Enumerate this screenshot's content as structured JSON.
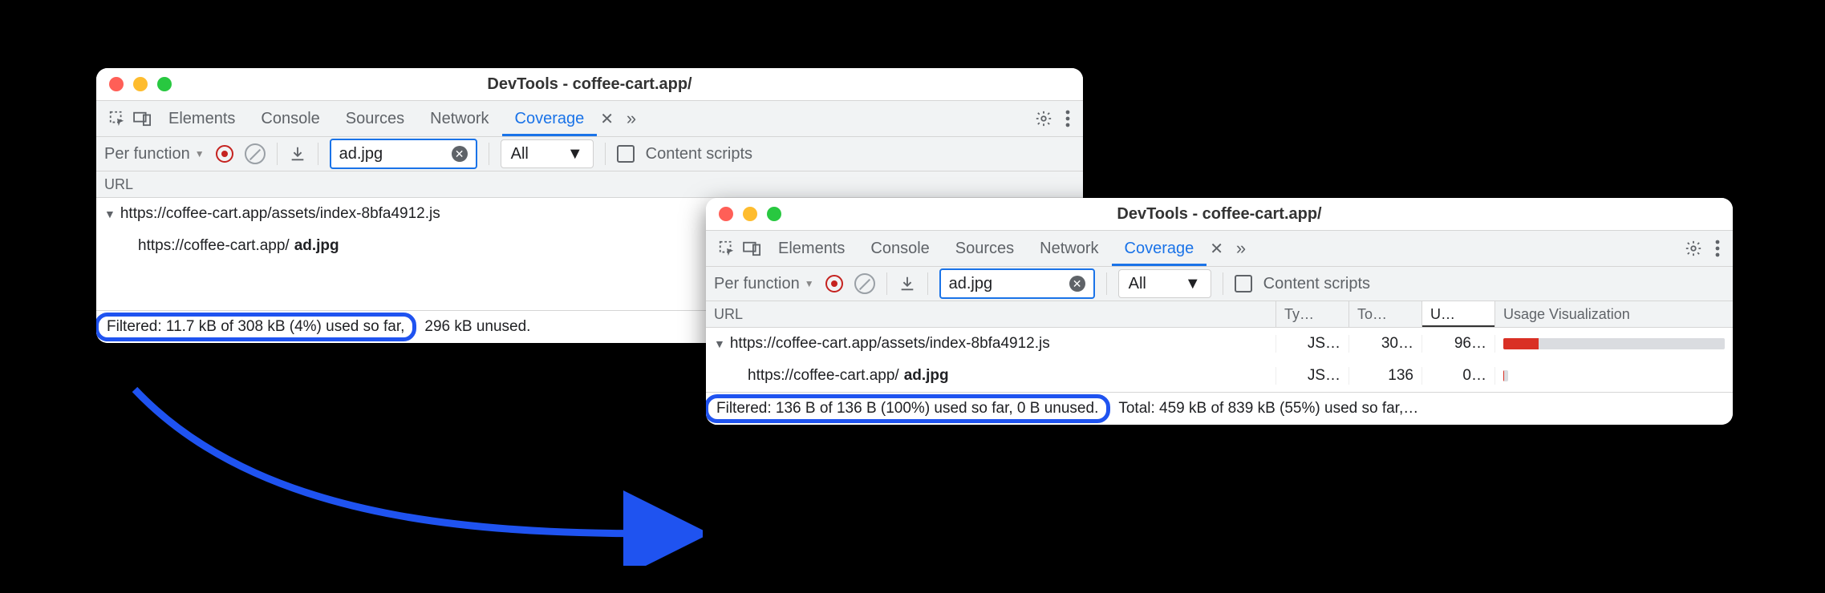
{
  "window_title": "DevTools - coffee-cart.app/",
  "tabs": {
    "elements": "Elements",
    "console": "Console",
    "sources": "Sources",
    "network": "Network",
    "coverage": "Coverage"
  },
  "toolbar": {
    "granularity": "Per function",
    "filter_value": "ad.jpg",
    "type_filter": "All",
    "content_scripts": "Content scripts"
  },
  "columns": {
    "url": "URL",
    "type": "Ty…",
    "total": "To…",
    "unused": "U…",
    "vis": "Usage Visualization"
  },
  "rows": {
    "r0_prefix": "https://coffee-cart.app/assets/index-8bfa4912.js",
    "r1_prefix": "https://coffee-cart.app/",
    "r1_bold": "ad.jpg"
  },
  "w1": {
    "status_filtered": "Filtered: 11.7 kB of 308 kB (4%) used so far,",
    "status_total": "296 kB unused."
  },
  "w2": {
    "r0": {
      "type": "JS…",
      "total": "30…",
      "unused": "96…",
      "used_pct": 16
    },
    "r1": {
      "type": "JS…",
      "total": "136",
      "unused": "0…",
      "used_pct": 2
    },
    "status_filtered": "Filtered: 136 B of 136 B (100%) used so far, 0 B unused.",
    "status_total": "Total: 459 kB of 839 kB (55%) used so far,…"
  }
}
